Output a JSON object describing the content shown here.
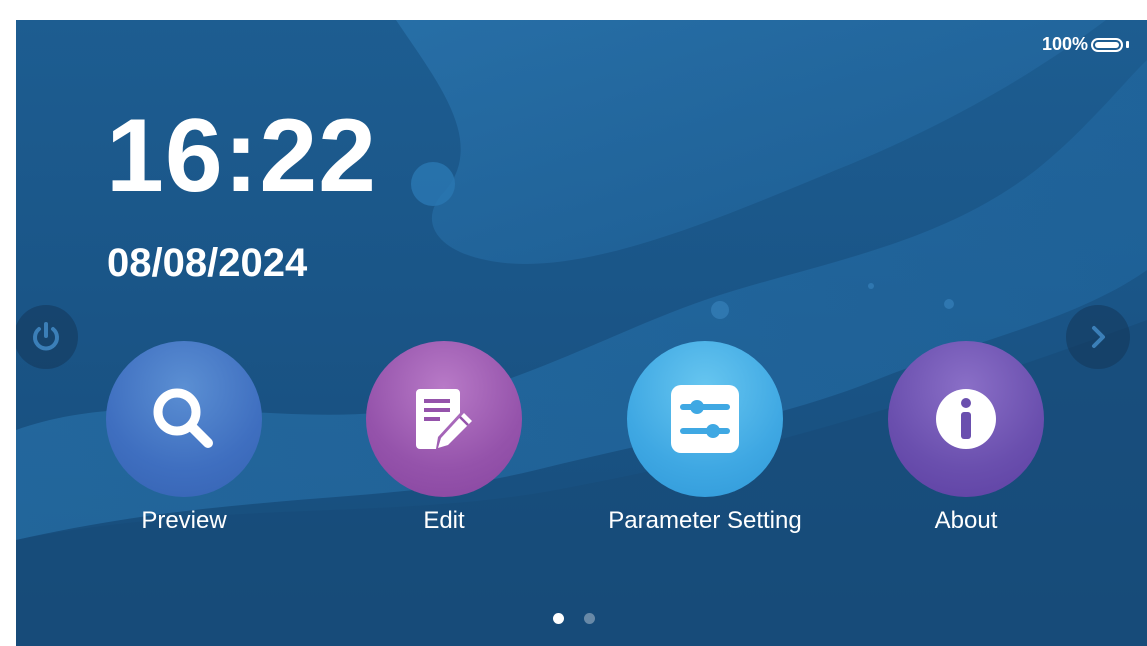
{
  "status": {
    "battery_text": "100%",
    "battery_level": 100
  },
  "clock": {
    "time": "16:22",
    "date": "08/08/2024"
  },
  "side_buttons": {
    "left_icon": "power-icon",
    "right_icon": "chevron-right-icon"
  },
  "apps": [
    {
      "label": "Preview",
      "icon": "search-icon",
      "color": "#3f6fc0"
    },
    {
      "label": "Edit",
      "icon": "edit-document-icon",
      "color": "#9553ab"
    },
    {
      "label": "Parameter Setting",
      "icon": "sliders-icon",
      "color": "#3fa8e3"
    },
    {
      "label": "About",
      "icon": "info-icon",
      "color": "#6a4fae"
    }
  ],
  "pager": {
    "total_pages": 2,
    "current_page": 1
  },
  "colors": {
    "background": "#1a5587",
    "text": "#ffffff"
  }
}
